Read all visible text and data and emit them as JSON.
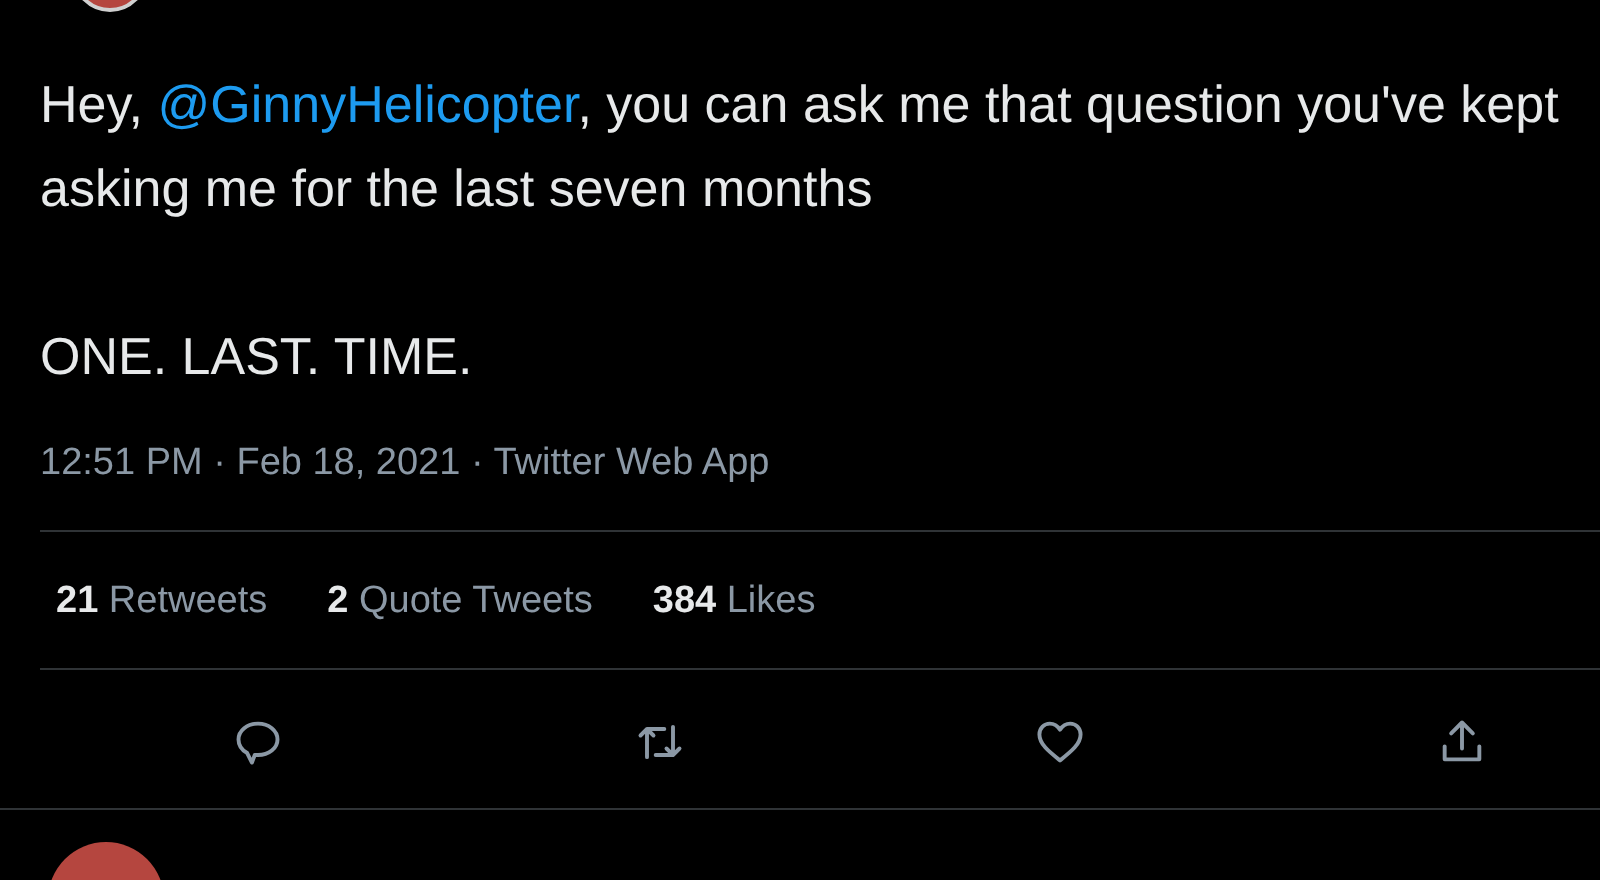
{
  "tweet": {
    "text_parts": [
      {
        "kind": "text",
        "text": "Hey, "
      },
      {
        "kind": "mention",
        "text": "@GinnyHelicopter"
      },
      {
        "kind": "text",
        "text": ", you can ask me that question you've kept asking me for the last seven months"
      }
    ],
    "second_paragraph": "ONE. LAST. TIME.",
    "meta": "12:51 PM · Feb 18, 2021 · Twitter Web App",
    "stats": [
      {
        "count": "21",
        "label": "Retweets"
      },
      {
        "count": "2",
        "label": "Quote Tweets"
      },
      {
        "count": "384",
        "label": "Likes"
      }
    ],
    "actions": [
      {
        "kind": "reply"
      },
      {
        "kind": "retweet"
      },
      {
        "kind": "like"
      },
      {
        "kind": "share"
      }
    ]
  }
}
